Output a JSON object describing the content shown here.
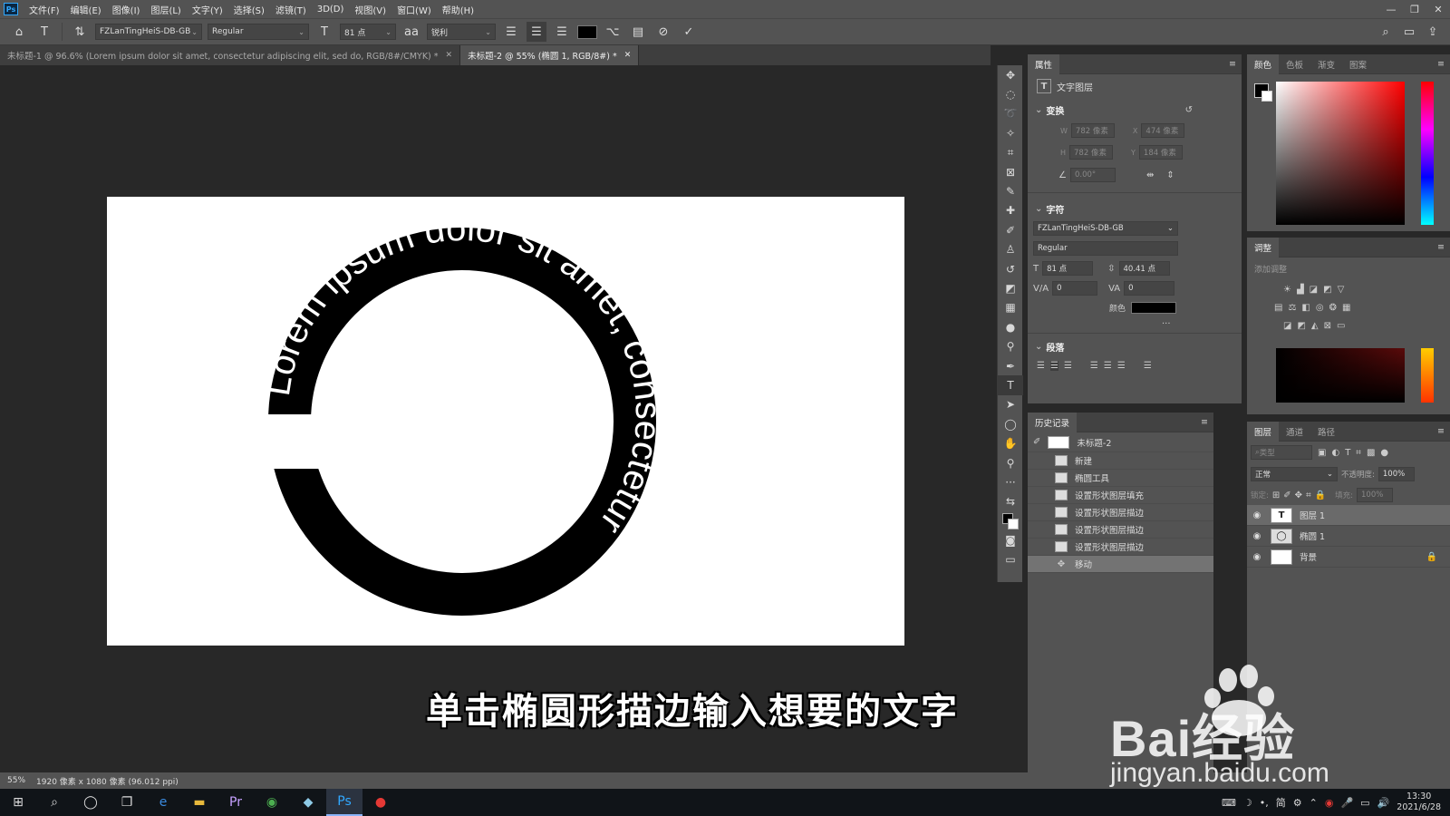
{
  "app": {
    "logo": "Ps"
  },
  "menu": [
    "文件(F)",
    "编辑(E)",
    "图像(I)",
    "图层(L)",
    "文字(Y)",
    "选择(S)",
    "滤镜(T)",
    "3D(D)",
    "视图(V)",
    "窗口(W)",
    "帮助(H)"
  ],
  "window_buttons": [
    "—",
    "❐",
    "✕"
  ],
  "options": {
    "font_family": "FZLanTingHeiS-DB-GB",
    "font_style": "Regular",
    "font_size": "81 点",
    "aa_label": "aa",
    "antialias": "锐利",
    "text_color": "#000000"
  },
  "tabs": [
    {
      "label": "未标题-1 @ 96.6% (Lorem ipsum dolor sit amet, consectetur adipiscing elit, sed do, RGB/8#/CMYK) *",
      "active": false
    },
    {
      "label": "未标题-2 @ 55% (椭圆 1, RGB/8#) *",
      "active": true
    }
  ],
  "canvas_text": "Lorem ipsum dolor sit amet, consectetur",
  "status": {
    "zoom": "55%",
    "doc_info": "1920 像素 x 1080 像素 (96.012 ppi)"
  },
  "properties": {
    "tab": "属性",
    "layer_type": "文字图层",
    "transform_title": "变换",
    "w": "782 像素",
    "x": "474 像素",
    "h": "782 像素",
    "y": "184 像素",
    "angle": "0.00°",
    "character_title": "字符",
    "font_family": "FZLanTingHeiS-DB-GB",
    "font_style": "Regular",
    "size": "81 点",
    "leading": "40.41 点",
    "kerning": "0",
    "tracking": "0",
    "color_label": "颜色",
    "more": "···",
    "paragraph_title": "段落"
  },
  "history": {
    "tab": "历史记录",
    "snapshot": "未标题-2",
    "items": [
      "新建",
      "椭圆工具",
      "设置形状图层填充",
      "设置形状图层描边",
      "设置形状图层描边",
      "设置形状图层描边",
      "移动"
    ],
    "selected_index": 6
  },
  "color_panel": {
    "tabs": [
      "颜色",
      "色板",
      "渐变",
      "图案"
    ]
  },
  "adjust_panel": {
    "tab": "调整",
    "hint": "添加调整"
  },
  "layers_panel": {
    "tabs": [
      "图层",
      "通道",
      "路径"
    ],
    "search_placeholder": "类型",
    "blend_mode": "正常",
    "opacity_label": "不透明度:",
    "opacity": "100%",
    "lock_label": "锁定:",
    "fill_label": "填充:",
    "fill": "100%",
    "layers": [
      {
        "name": "图层 1",
        "thumb": "T",
        "selected": true
      },
      {
        "name": "椭圆 1",
        "thumb": "",
        "selected": false
      },
      {
        "name": "背景",
        "thumb": "",
        "selected": false
      }
    ]
  },
  "subtitle": "单击椭圆形描边输入想要的文字",
  "watermark": {
    "brand": "Bai经验",
    "url": "jingyan.baidu.com"
  },
  "taskbar": {
    "time": "13:30",
    "date": "2021/6/28",
    "ime": "简"
  }
}
